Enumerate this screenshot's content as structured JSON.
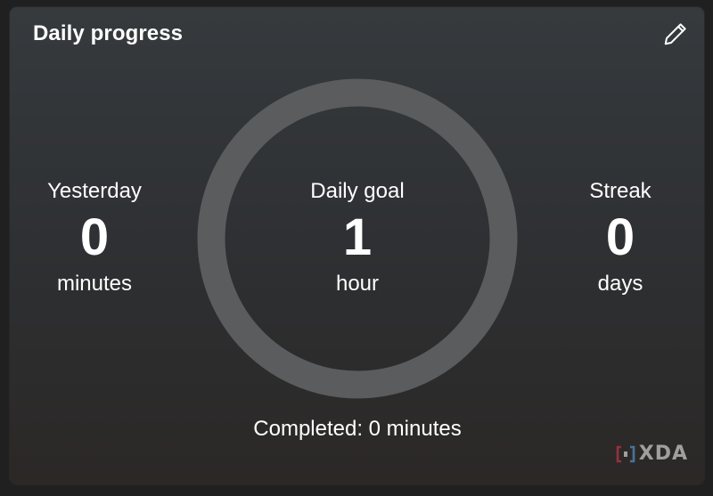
{
  "widget": {
    "title": "Daily progress",
    "edit_icon": "pencil-icon"
  },
  "yesterday": {
    "label": "Yesterday",
    "value": "0",
    "unit": "minutes"
  },
  "daily_goal": {
    "label": "Daily goal",
    "value": "1",
    "unit": "hour",
    "progress_fraction": 0
  },
  "streak": {
    "label": "Streak",
    "value": "0",
    "unit": "days"
  },
  "completed_text": "Completed: 0 minutes",
  "watermark": {
    "text": "XDA",
    "icon": "xda-logo-icon"
  },
  "colors": {
    "ring_track": "#5a5c5e",
    "text": "#ffffff"
  }
}
